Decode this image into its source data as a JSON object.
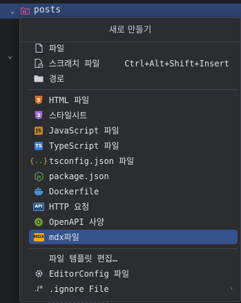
{
  "tree": {
    "selected_folder": "posts"
  },
  "popup": {
    "title": "새로 만들기",
    "items": [
      {
        "label": "파일",
        "icon": "file-icon"
      },
      {
        "label": "스크래치 파일",
        "icon": "scratch-file-icon",
        "shortcut": "Ctrl+Alt+Shift+Insert"
      },
      {
        "label": "경로",
        "icon": "folder-icon"
      },
      {
        "label": "HTML 파일",
        "icon": "html-icon"
      },
      {
        "label": "스타일시트",
        "icon": "css-icon"
      },
      {
        "label": "JavaScript 파일",
        "icon": "javascript-icon"
      },
      {
        "label": "TypeScript 파일",
        "icon": "typescript-icon"
      },
      {
        "label": "tsconfig.json 파일",
        "icon": "tsconfig-icon"
      },
      {
        "label": "package.json",
        "icon": "nodejs-icon"
      },
      {
        "label": "Dockerfile",
        "icon": "docker-icon"
      },
      {
        "label": "HTTP 요청",
        "icon": "http-api-icon"
      },
      {
        "label": "OpenAPI 사양",
        "icon": "openapi-icon"
      },
      {
        "label": "mdx파일",
        "icon": "mdx-icon"
      },
      {
        "label": "파일 템플릿 편집…",
        "icon": ""
      },
      {
        "label": "EditorConfig 파일",
        "icon": "gear-icon"
      },
      {
        "label": ".ignore File",
        "icon": "ignore-file-icon"
      }
    ]
  }
}
